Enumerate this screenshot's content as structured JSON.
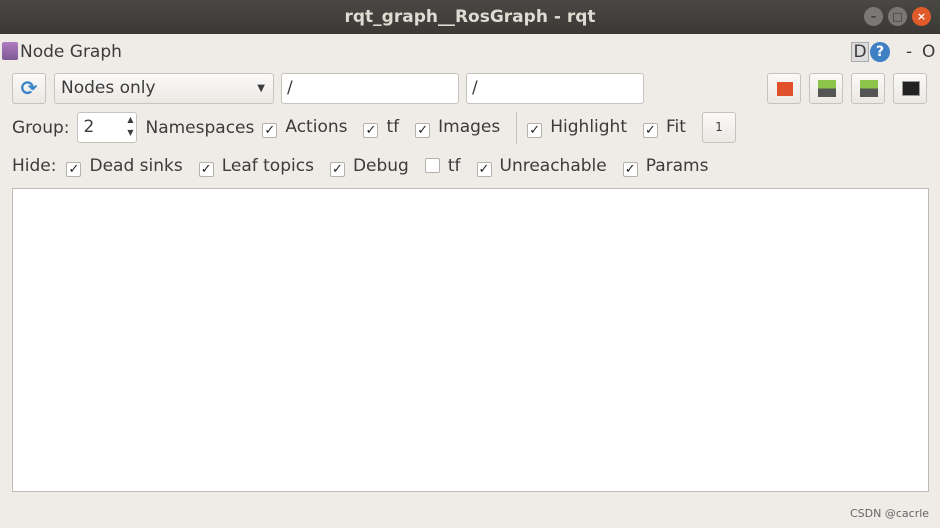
{
  "window": {
    "title": "rqt_graph__RosGraph - rqt"
  },
  "plugin": {
    "title": "Node Graph",
    "d_label": "D",
    "help_label": "?",
    "minus_label": "-",
    "o_label": "O"
  },
  "toolbar": {
    "mode": "Nodes only",
    "filter1": "/",
    "filter2": "/"
  },
  "row2": {
    "group_label": "Group:",
    "group_value": "2",
    "items": [
      {
        "label": "Namespaces",
        "checked": null
      },
      {
        "label": "Actions",
        "checked": true
      },
      {
        "label": "tf",
        "checked": true
      },
      {
        "label": "Images",
        "checked": true
      },
      {
        "label": "Highlight",
        "checked": true
      },
      {
        "label": "Fit",
        "checked": true
      }
    ],
    "fit_button": "1"
  },
  "row3": {
    "hide_label": "Hide:",
    "items": [
      {
        "label": "Dead sinks",
        "checked": true
      },
      {
        "label": "Leaf topics",
        "checked": true
      },
      {
        "label": "Debug",
        "checked": true
      },
      {
        "label": "tf",
        "checked": false
      },
      {
        "label": "Unreachable",
        "checked": true
      },
      {
        "label": "Params",
        "checked": true
      }
    ]
  },
  "watermark": "CSDN @cacrle"
}
